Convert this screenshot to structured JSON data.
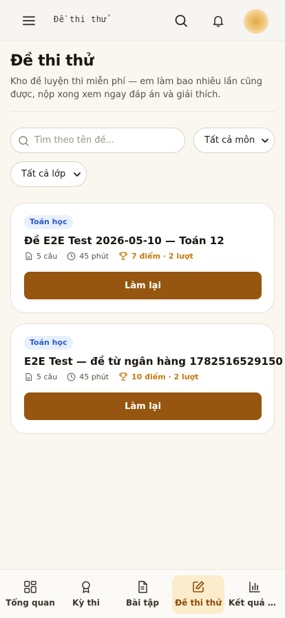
{
  "header": {
    "app_title": "Đề thi thử",
    "menu_icon": "hamburger-menu-icon",
    "search_icon": "search-icon",
    "bell_icon": "bell-icon"
  },
  "page": {
    "title": "Đề thi thử",
    "description": "Kho đề luyện thi miễn phí — em làm bao nhiêu lần cũng được, nộp xong xem ngay đáp án và giải thích."
  },
  "filters": {
    "search_placeholder": "Tìm theo tên đề...",
    "search_value": "",
    "subject_selected": "Tất cả môn",
    "grade_selected": "Tất cả lớp"
  },
  "exams": [
    {
      "subject": "Toán học",
      "title": "Đề E2E Test 2026-05-10 — Toán 12",
      "questions": "5 câu",
      "duration": "45 phút",
      "score": "7 điểm · 2 lượt",
      "action": "Làm lại"
    },
    {
      "subject": "Toán học",
      "title": "E2E Test — đề từ ngân hàng 1782516529150",
      "questions": "5 câu",
      "duration": "45 phút",
      "score": "10 điểm · 2 lượt",
      "action": "Làm lại"
    }
  ],
  "bottom_nav": [
    {
      "label": "Tổng quan",
      "icon": "grid-icon"
    },
    {
      "label": "Kỳ thi",
      "icon": "award-icon"
    },
    {
      "label": "Bài tập",
      "icon": "document-icon"
    },
    {
      "label": "Đề thi thử",
      "icon": "edit-icon",
      "active": true
    },
    {
      "label": "Kết quả học tập",
      "icon": "bar-chart-icon"
    }
  ],
  "colors": {
    "accent": "#96560f",
    "score": "#c47a12",
    "badge_bg": "#e8f0fd",
    "badge_text": "#2b5cc4",
    "nav_active_bg": "#fbeccc"
  }
}
